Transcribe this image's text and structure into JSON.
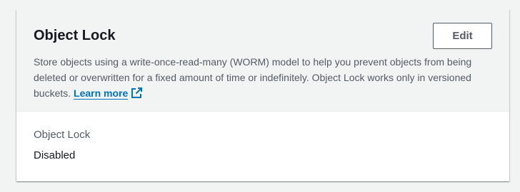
{
  "panel": {
    "title": "Object Lock",
    "edit_label": "Edit",
    "description": "Store objects using a write-once-read-many (WORM) model to help you prevent objects from being deleted or overwritten for a fixed amount of time or indefinitely. Object Lock works only in versioned buckets.",
    "learn_more_label": "Learn more",
    "learn_more_icon": "external-link-icon"
  },
  "field": {
    "label": "Object Lock",
    "value": "Disabled"
  },
  "colors": {
    "link": "#0073bb",
    "text_primary": "#16191f",
    "text_secondary": "#545b64",
    "header_background": "#f2f3f3"
  }
}
